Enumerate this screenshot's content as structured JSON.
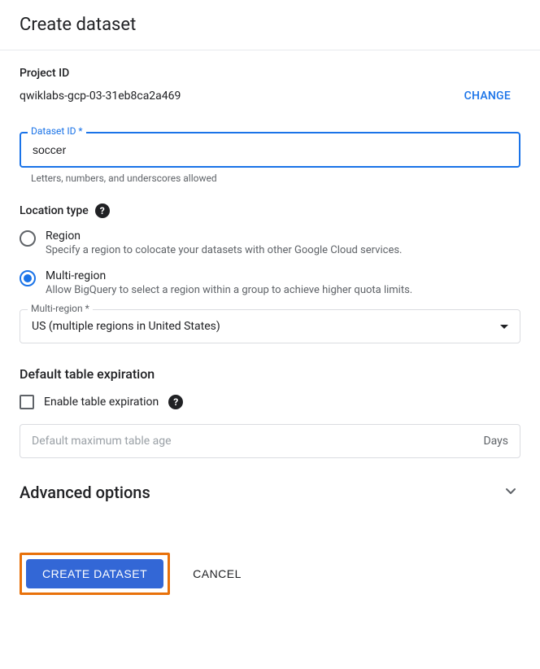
{
  "header": {
    "title": "Create dataset"
  },
  "project": {
    "label": "Project ID",
    "value": "qwiklabs-gcp-03-31eb8ca2a469",
    "change_label": "CHANGE"
  },
  "dataset_id": {
    "label": "Dataset ID *",
    "value": "soccer",
    "helper": "Letters, numbers, and underscores allowed"
  },
  "location_type": {
    "label": "Location type",
    "options": [
      {
        "title": "Region",
        "desc": "Specify a region to colocate your datasets with other Google Cloud services.",
        "selected": false
      },
      {
        "title": "Multi-region",
        "desc": "Allow BigQuery to select a region within a group to achieve higher quota limits.",
        "selected": true
      }
    ]
  },
  "multi_region": {
    "label": "Multi-region *",
    "value": "US (multiple regions in United States)"
  },
  "expiration": {
    "title": "Default table expiration",
    "checkbox_label": "Enable table expiration",
    "max_age_placeholder": "Default maximum table age",
    "unit": "Days"
  },
  "advanced": {
    "title": "Advanced options"
  },
  "actions": {
    "submit": "CREATE DATASET",
    "cancel": "CANCEL"
  }
}
